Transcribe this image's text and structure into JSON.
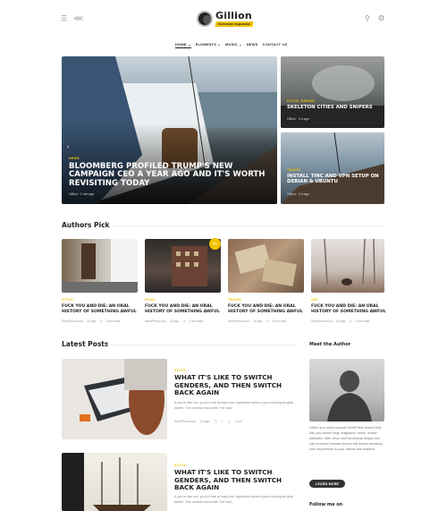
{
  "header": {
    "logo_title": "Gillion",
    "logo_tagline": "Extremely responsive",
    "nav": [
      {
        "label": "HOME",
        "caret": "⌄"
      },
      {
        "label": "ELEMENTS",
        "caret": "⌄"
      },
      {
        "label": "MUSIC",
        "caret": "⌄"
      },
      {
        "label": "NEWS",
        "caret": ""
      },
      {
        "label": "CONTACT US",
        "caret": ""
      }
    ]
  },
  "hero": {
    "main": {
      "category": "NEWS",
      "title": "BLOOMBERG PROFILED TRUMP'S NEW CAMPAIGN CEO A YEAR AGO AND IT'S WORTH REVISITING TODAY",
      "meta": "Gillion  ·  2 min ago"
    },
    "side1": {
      "category": "STYLE, DESIGN",
      "title": "SKELETON CITIES AND SNIPERS",
      "meta": "Gillion  ·  4 h ago"
    },
    "side2": {
      "category": "TRAVEL",
      "title": "INSTALL TINC AND VPN SETUP ON DEBIAN & UBUNTU",
      "meta": "Gillion  ·  4 h ago"
    }
  },
  "authors_pick": {
    "title": "Authors Pick",
    "badge": "7+",
    "items": [
      {
        "category": "STYLE",
        "title": "FUCK YOU AND DIE: AN ORAL HISTORY OF SOMETHING AWFUL",
        "author": "WordPress.com",
        "time": "2d ago",
        "read": "3 min read"
      },
      {
        "category": "FOOD",
        "title": "FUCK YOU AND DIE: AN ORAL HISTORY OF SOMETHING AWFUL",
        "author": "WordPress.com",
        "time": "2d ago",
        "read": "3 min read"
      },
      {
        "category": "TRAVEL",
        "title": "FUCK YOU AND DIE: AN ORAL HISTORY OF SOMETHING AWFUL",
        "author": "WordPress.com",
        "time": "2d ago",
        "read": "3 min read"
      },
      {
        "category": "ART",
        "title": "FUCK YOU AND DIE: AN ORAL HISTORY OF SOMETHING AWFUL",
        "author": "WordPress.com",
        "time": "2d ago",
        "read": "3 min read"
      }
    ]
  },
  "latest": {
    "title": "Latest Posts",
    "posts": [
      {
        "category": "STYLE",
        "title": "WHAT IT'S LIKE TO SWITCH GENDERS, AND THEN SWITCH BACK AGAIN",
        "excerpt": "If you're like me, you've had at least one nightmare where your motorcycle gets stolen. The closest encounter I've had...",
        "author": "WordPress.com",
        "time": "2d ago",
        "comments": "2",
        "read": "3 min"
      },
      {
        "category": "STYLE",
        "title": "WHAT IT'S LIKE TO SWITCH GENDERS, AND THEN SWITCH BACK AGAIN",
        "excerpt": "If you're like me, you've had at least one nightmare where your motorcycle gets stolen. The closest encounter I've had..."
      }
    ]
  },
  "sidebar": {
    "meet_title": "Meet the Author",
    "about": "Gillion is a multi-concept WordPress theme that lets you create blog, magazine, news, review websites. With clean and functional design and lots of useful features theme will deliver amazing user experience to your clients and readers.",
    "button": "LEARN MORE",
    "follow_title": "Follow me on"
  },
  "colors": {
    "accent": "#f2c200",
    "text": "#222222"
  }
}
